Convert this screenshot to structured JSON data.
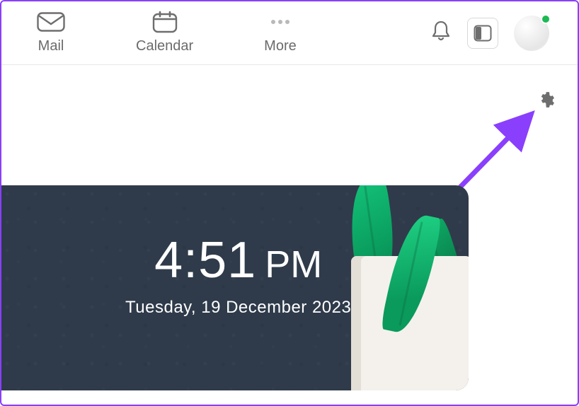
{
  "nav": {
    "items": [
      {
        "label": "Mail",
        "icon": "mail-icon"
      },
      {
        "label": "Calendar",
        "icon": "calendar-icon"
      },
      {
        "label": "More",
        "icon": "more-icon"
      }
    ]
  },
  "header": {
    "notifications_icon": "bell-icon",
    "sidebar_toggle_icon": "panel-icon",
    "presence_color": "#1db954"
  },
  "settings_icon": "gear-icon",
  "annotation": {
    "arrow_color": "#8a3ffc"
  },
  "clock_widget": {
    "time": "4:51",
    "ampm": "PM",
    "date": "Tuesday, 19 December 2023",
    "bg_color": "#2f3b4a"
  }
}
